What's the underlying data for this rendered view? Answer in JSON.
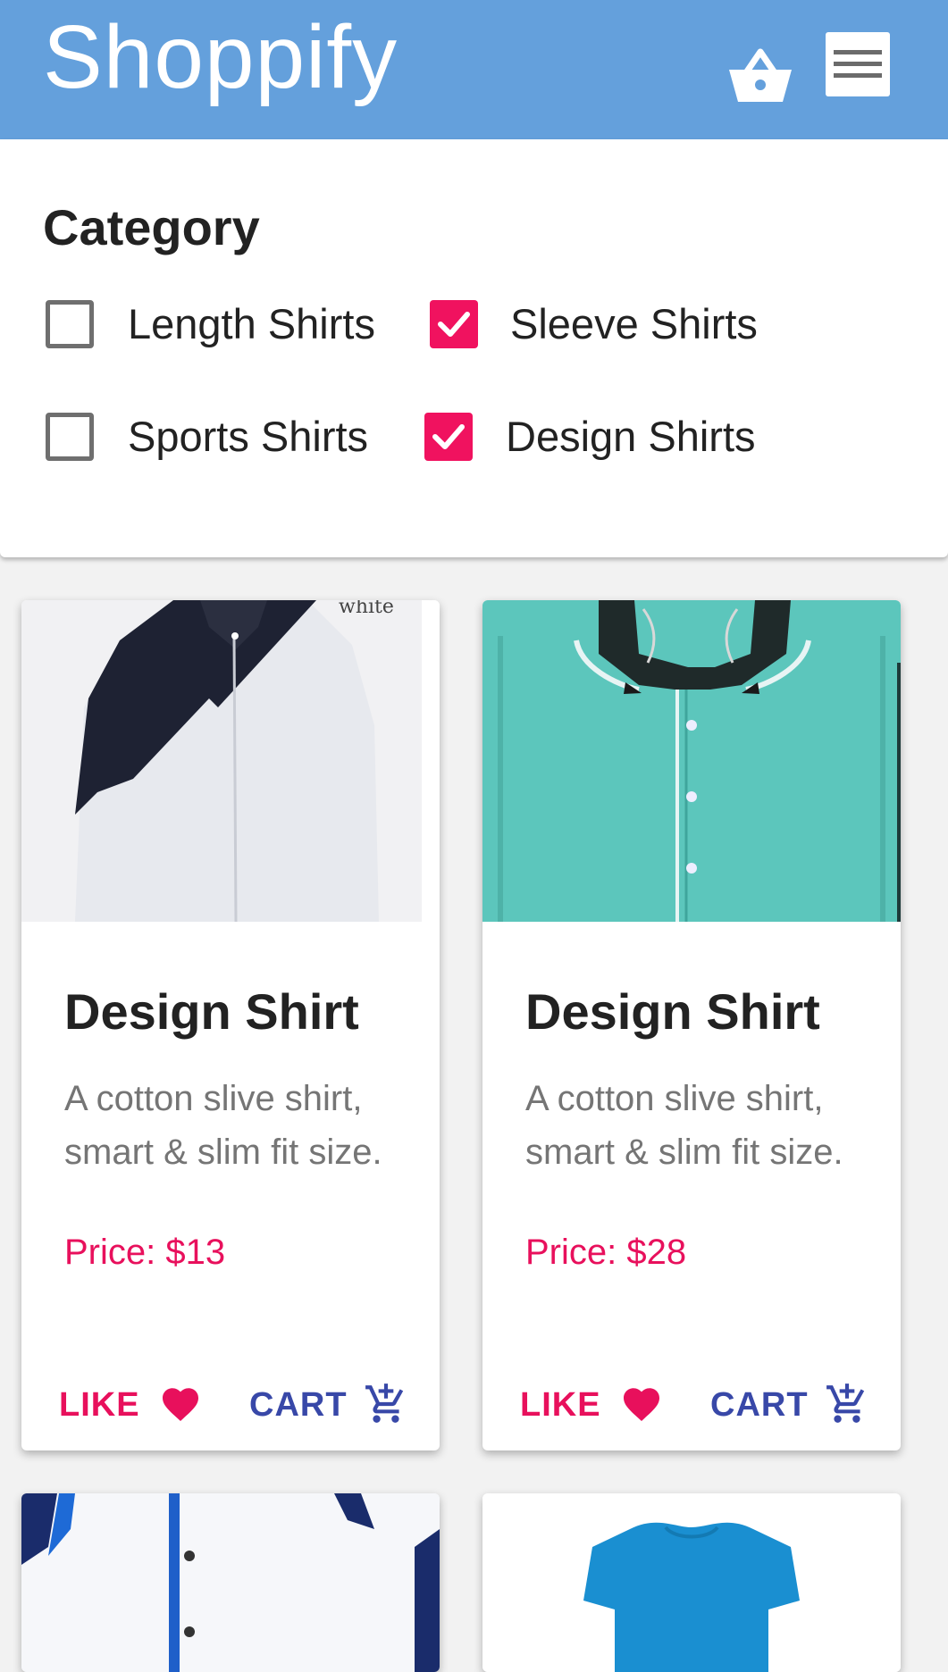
{
  "app": {
    "title": "Shoppify",
    "icons": [
      "basket-icon",
      "menu-icon"
    ]
  },
  "filter": {
    "title": "Category",
    "options": [
      {
        "label": "Length Shirts",
        "checked": false
      },
      {
        "label": "Sleeve Shirts",
        "checked": true
      },
      {
        "label": "Sports Shirts",
        "checked": false
      },
      {
        "label": "Design Shirts",
        "checked": true
      }
    ]
  },
  "products": [
    {
      "title": "Design Shirt",
      "description": "A cotton slive shirt, smart & slim fit size.",
      "price": "Price: $13",
      "like_label": "LIKE",
      "cart_label": "CART",
      "image": "black-white-diagonal-shirt",
      "image_text": "white"
    },
    {
      "title": "Design Shirt",
      "description": "A cotton slive shirt, smart & slim fit size.",
      "price": "Price: $28",
      "like_label": "LIKE",
      "cart_label": "CART",
      "image": "turquoise-western-shirt"
    },
    {
      "image": "white-blue-shirt"
    },
    {
      "image": "blue-tshirt"
    }
  ],
  "colors": {
    "appbar": "#64a0dc",
    "accent": "#e8105c",
    "cart": "#3848a8",
    "checkbox": "#f0125f"
  }
}
